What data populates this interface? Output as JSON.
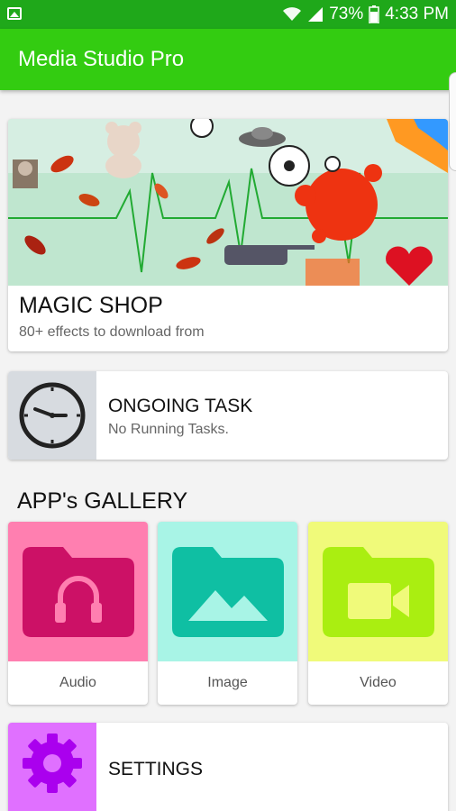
{
  "status_bar": {
    "battery": "73%",
    "time": "4:33 PM",
    "icons": [
      "gallery-notification-icon",
      "wifi-icon",
      "signal-icon",
      "battery-icon"
    ]
  },
  "app_bar": {
    "title": "Media Studio Pro"
  },
  "magic_shop": {
    "title": "MAGIC SHOP",
    "subtitle": "80+ effects to download from"
  },
  "ongoing_task": {
    "title": "ONGOING TASK",
    "subtitle": "No Running Tasks.",
    "icon": "clock-icon"
  },
  "gallery": {
    "heading": "APP's GALLERY",
    "tiles": [
      {
        "label": "Audio",
        "icon": "headphones-folder-icon",
        "bg": "#ff7fb0",
        "fg": "#cc1166"
      },
      {
        "label": "Image",
        "icon": "image-folder-icon",
        "bg": "#a8f4e6",
        "fg": "#0fbfa3"
      },
      {
        "label": "Video",
        "icon": "video-folder-icon",
        "bg": "#f0fa7a",
        "fg": "#aaee11"
      }
    ]
  },
  "settings": {
    "title": "SETTINGS",
    "icon": "gear-icon",
    "bg": "#e070ff",
    "fg": "#aa00ee"
  },
  "colors": {
    "status_bar": "#1fa81a",
    "app_bar": "#33cc11",
    "page_bg": "#f3f3f3"
  }
}
